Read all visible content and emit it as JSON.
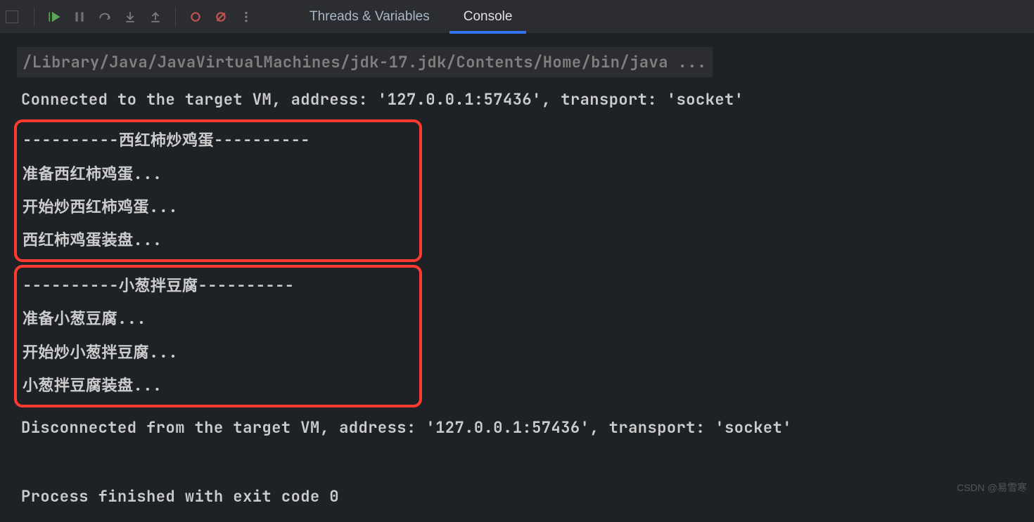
{
  "tabs": {
    "threads_variables": "Threads & Variables",
    "console": "Console"
  },
  "console": {
    "command": "/Library/Java/JavaVirtualMachines/jdk-17.jdk/Contents/Home/bin/java ...",
    "connected": "Connected to the target VM, address: '127.0.0.1:57436', transport: 'socket'",
    "block1": {
      "header": "----------西红柿炒鸡蛋----------",
      "line1": "准备西红柿鸡蛋...",
      "line2": "开始炒西红柿鸡蛋...",
      "line3": "西红柿鸡蛋装盘..."
    },
    "block2": {
      "header": "----------小葱拌豆腐----------",
      "line1": "准备小葱豆腐...",
      "line2": "开始炒小葱拌豆腐...",
      "line3": "小葱拌豆腐装盘..."
    },
    "disconnected": "Disconnected from the target VM, address: '127.0.0.1:57436', transport: 'socket'",
    "exit": "Process finished with exit code 0"
  },
  "watermark": "CSDN @易雪寒"
}
